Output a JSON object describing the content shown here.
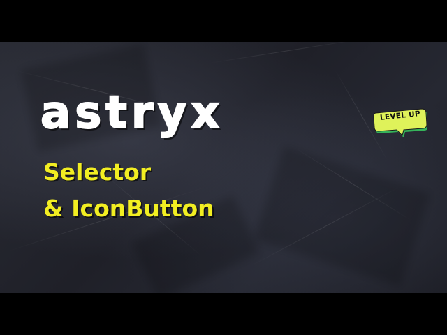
{
  "thumbnail": {
    "logo": "astryx",
    "subtitle_line1": "Selector",
    "subtitle_line2": "& IconButton",
    "badge": "LEVEL UP"
  },
  "colors": {
    "background": "#000000",
    "paper": "#23252e",
    "logo": "#ffffff",
    "subtitle": "#f2ee22",
    "badge_fill": "#dff25a",
    "badge_shadow": "#35b35a"
  }
}
